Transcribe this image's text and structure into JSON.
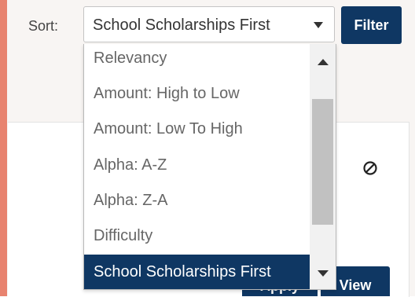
{
  "sort": {
    "label": "Sort:",
    "selected_value": "School Scholarships First",
    "options": [
      "Relevancy",
      "Amount: High to Low",
      "Amount: Low To High",
      "Alpha: A-Z",
      "Alpha: Z-A",
      "Difficulty",
      "School Scholarships First"
    ]
  },
  "filter_button": "Filter",
  "card": {
    "apply_button": "Apply",
    "view_button": "View",
    "hide_icon": "block-icon"
  },
  "colors": {
    "primary": "#0f3763",
    "accent_stripe": "#e8836f"
  }
}
